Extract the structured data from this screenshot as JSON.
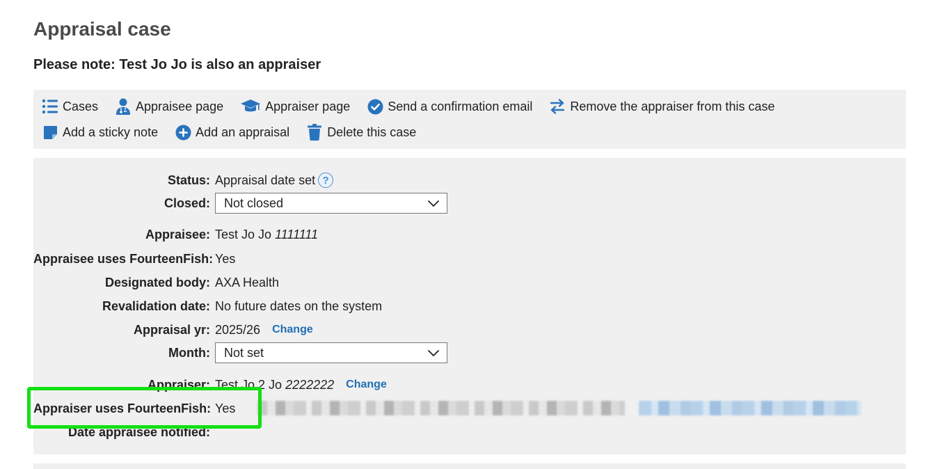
{
  "page": {
    "title": "Appraisal case",
    "note": "Please note: Test Jo Jo is also an appraiser"
  },
  "toolbar": {
    "items": [
      {
        "label": "Cases",
        "icon": "list-icon"
      },
      {
        "label": "Appraisee page",
        "icon": "doctor-icon"
      },
      {
        "label": "Appraiser page",
        "icon": "graduation-cap-icon"
      },
      {
        "label": "Send a confirmation email",
        "icon": "check-circle-icon"
      },
      {
        "label": "Remove the appraiser from this case",
        "icon": "swap-arrows-icon"
      },
      {
        "label": "Add a sticky note",
        "icon": "sticky-note-icon"
      },
      {
        "label": "Add an appraisal",
        "icon": "plus-circle-icon"
      },
      {
        "label": "Delete this case",
        "icon": "trash-icon"
      }
    ],
    "icon_color": "#2a73bd"
  },
  "details": {
    "status": {
      "label": "Status:",
      "value": "Appraisal date set",
      "help": "?"
    },
    "closed": {
      "label": "Closed:",
      "value": "Not closed"
    },
    "appraisee": {
      "label": "Appraisee:",
      "name": "Test Jo Jo",
      "id": "1111111"
    },
    "appraisee_ff": {
      "label": "Appraisee uses FourteenFish:",
      "value": "Yes"
    },
    "designated_body": {
      "label": "Designated body:",
      "value": "AXA Health"
    },
    "revalidation": {
      "label": "Revalidation date:",
      "value": "No future dates on the system"
    },
    "appraisal_yr": {
      "label": "Appraisal yr:",
      "value": "2025/26",
      "change": "Change"
    },
    "month": {
      "label": "Month:",
      "value": "Not set"
    },
    "appraiser": {
      "label": "Appraiser:",
      "name": "Test Jo 2 Jo",
      "id": "2222222",
      "change": "Change"
    },
    "appraiser_ff": {
      "label": "Appraiser uses FourteenFish:",
      "value": "Yes"
    },
    "date_notified": {
      "label": "Date appraisee notified:"
    }
  },
  "colors": {
    "link": "#1f6fb5",
    "panel_bg": "#f0f0f0",
    "highlight": "#12e012"
  }
}
